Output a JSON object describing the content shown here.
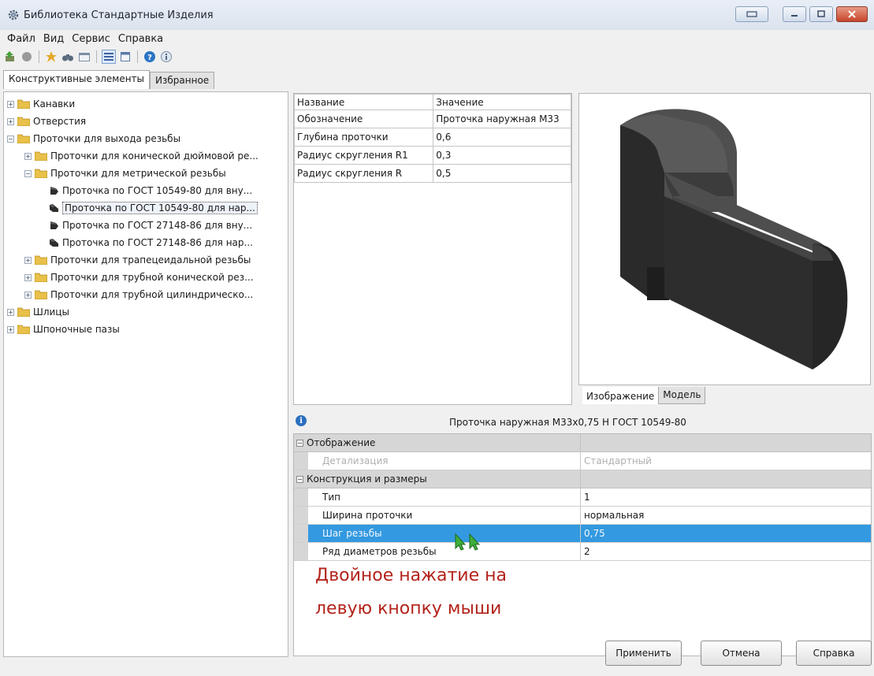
{
  "window": {
    "title": "Библиотека Стандартные Изделия"
  },
  "menu": [
    "Файл",
    "Вид",
    "Сервис",
    "Справка"
  ],
  "tabs": [
    "Конструктивные элементы",
    "Избранное"
  ],
  "tree": [
    {
      "label": "Канавки",
      "level": 0,
      "type": "folder",
      "expander": "+"
    },
    {
      "label": "Отверстия",
      "level": 0,
      "type": "folder",
      "expander": "+"
    },
    {
      "label": "Проточки для выхода резьбы",
      "level": 0,
      "type": "folder",
      "expander": "−"
    },
    {
      "label": "Проточки для конической дюймовой ре...",
      "level": 1,
      "type": "folder",
      "expander": "+"
    },
    {
      "label": "Проточки для метрической резьбы",
      "level": 1,
      "type": "folder",
      "expander": "−"
    },
    {
      "label": "Проточка по ГОСТ 10549-80 для вну...",
      "level": 2,
      "type": "item"
    },
    {
      "label": "Проточка по ГОСТ 10549-80 для нар...",
      "level": 2,
      "type": "item",
      "selected": true
    },
    {
      "label": "Проточка по ГОСТ 27148-86 для вну...",
      "level": 2,
      "type": "item"
    },
    {
      "label": "Проточка по ГОСТ 27148-86 для нар...",
      "level": 2,
      "type": "item"
    },
    {
      "label": "Проточки для трапецеидальной резьбы",
      "level": 1,
      "type": "folder",
      "expander": "+"
    },
    {
      "label": "Проточки для трубной конической рез...",
      "level": 1,
      "type": "folder",
      "expander": "+"
    },
    {
      "label": "Проточки для трубной цилиндрическо...",
      "level": 1,
      "type": "folder",
      "expander": "+"
    },
    {
      "label": "Шлицы",
      "level": 0,
      "type": "folder",
      "expander": "+"
    },
    {
      "label": "Шпоночные пазы",
      "level": 0,
      "type": "folder",
      "expander": "+"
    }
  ],
  "params": {
    "headers": [
      "Название",
      "Значение"
    ],
    "rows": [
      [
        "Обозначение",
        "Проточка наружная М33"
      ],
      [
        "Глубина проточки",
        "0,6"
      ],
      [
        "Радиус скругления R1",
        "0,3"
      ],
      [
        "Радиус скругления R",
        "0,5"
      ]
    ]
  },
  "preview_tabs": [
    "Изображение",
    "Модель"
  ],
  "info": {
    "text": "Проточка наружная М33х0,75 Н ГОСТ 10549-80"
  },
  "properties": [
    {
      "kind": "category",
      "name": "Отображение",
      "value": ""
    },
    {
      "kind": "row",
      "name": "Детализация",
      "value": "Стандартный",
      "disabled": true
    },
    {
      "kind": "category",
      "name": "Конструкция и размеры",
      "value": ""
    },
    {
      "kind": "row",
      "name": "Тип",
      "value": "1"
    },
    {
      "kind": "row",
      "name": "Ширина проточки",
      "value": "нормальная"
    },
    {
      "kind": "row",
      "name": "Шаг резьбы",
      "value": "0,75",
      "selected": true
    },
    {
      "kind": "row",
      "name": "Ряд диаметров резьбы",
      "value": "2"
    }
  ],
  "annotation": {
    "line1": "Двойное нажатие на",
    "line2": "левую кнопку мыши"
  },
  "buttons": {
    "apply": "Применить",
    "cancel": "Отмена",
    "help": "Справка"
  },
  "colors": {
    "selection": "#3399e0",
    "annotation": "#b3231b",
    "folder": "#e8c04a"
  }
}
